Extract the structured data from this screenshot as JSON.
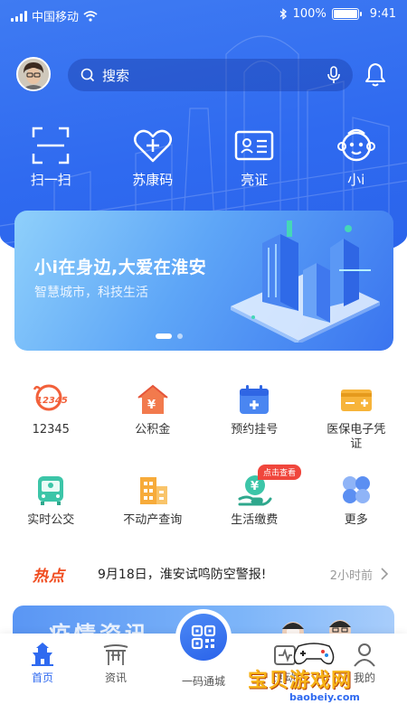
{
  "status_bar": {
    "carrier": "中国移动",
    "battery_percent": "100%",
    "battery_level": 1.0,
    "time": "9:41"
  },
  "header": {
    "search_placeholder": "搜索",
    "icons": [
      "avatar",
      "search-icon",
      "microphone-icon",
      "bell-icon"
    ]
  },
  "quick_actions": [
    {
      "label": "扫一扫",
      "icon": "scan-icon"
    },
    {
      "label": "苏康码",
      "icon": "heart-plus-icon"
    },
    {
      "label": "亮证",
      "icon": "id-card-icon"
    },
    {
      "label": "小i",
      "icon": "robot-monkey-icon"
    }
  ],
  "banner": {
    "title": "小i在身边,大爱在淮安",
    "subtitle": "智慧城市，科技生活",
    "slides": 2,
    "active_slide": 1
  },
  "services": [
    {
      "label": "12345",
      "icon": "hotline-12345-icon"
    },
    {
      "label": "公积金",
      "icon": "housing-fund-icon"
    },
    {
      "label": "预约挂号",
      "icon": "calendar-appointment-icon"
    },
    {
      "label": "医保电子凭证",
      "icon": "medical-insurance-card-icon"
    },
    {
      "label": "实时公交",
      "icon": "bus-icon"
    },
    {
      "label": "不动产查询",
      "icon": "building-icon"
    },
    {
      "label": "生活缴费",
      "icon": "payment-hand-icon",
      "tag": "点击查看"
    },
    {
      "label": "更多",
      "icon": "more-grid-icon"
    }
  ],
  "hot_news": {
    "badge": "热点",
    "text": "9月18日，淮安试鸣防空警报!",
    "time": "2小时前"
  },
  "promo_card": {
    "title": "疫情资讯"
  },
  "tab_bar": {
    "tabs": [
      {
        "label": "首页",
        "icon": "home-pagoda-icon",
        "active": true
      },
      {
        "label": "资讯",
        "icon": "news-gate-icon",
        "active": false
      },
      {
        "label": "一码通城",
        "icon": "qr-code-icon",
        "active": false
      },
      {
        "label": "活动",
        "icon": "activity-icon",
        "active": false
      },
      {
        "label": "我的",
        "icon": "profile-icon",
        "active": false
      }
    ]
  },
  "watermark": {
    "text": "宝贝游戏网",
    "url": "baobeiy.com"
  },
  "colors": {
    "primary": "#2f6af0",
    "hot_badge": "#f04b1e",
    "tag_red": "#f0463c"
  }
}
